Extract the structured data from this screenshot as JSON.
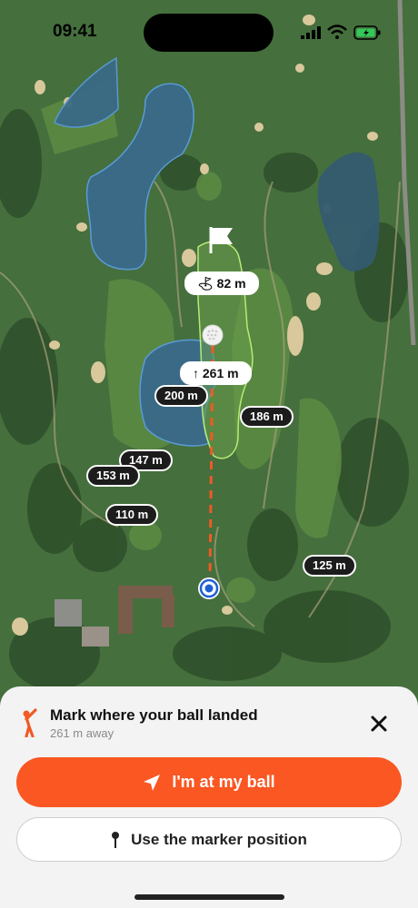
{
  "status_bar": {
    "time": "09:41"
  },
  "map": {
    "icons": {
      "flag": "flag-icon",
      "ball": "golf-ball-icon",
      "player": "player-location-icon"
    },
    "pin_distance": "82 m",
    "shot_distance": "261 m",
    "distance_markers": [
      "200 m",
      "186 m",
      "147 m",
      "153 m",
      "110 m",
      "125 m"
    ],
    "colors": {
      "shot_line": "#f05a24",
      "water": "#3a6a86",
      "player": "#1f5fd6"
    }
  },
  "sheet": {
    "title": "Mark where your ball landed",
    "subtitle": "261 m away",
    "primary_button": "I'm at my ball",
    "secondary_button": "Use the marker position",
    "icons": {
      "golfer": "golfer-icon",
      "close": "close-icon",
      "navigate": "location-arrow-icon",
      "pin": "pin-icon"
    },
    "accent": "#fa5722"
  }
}
